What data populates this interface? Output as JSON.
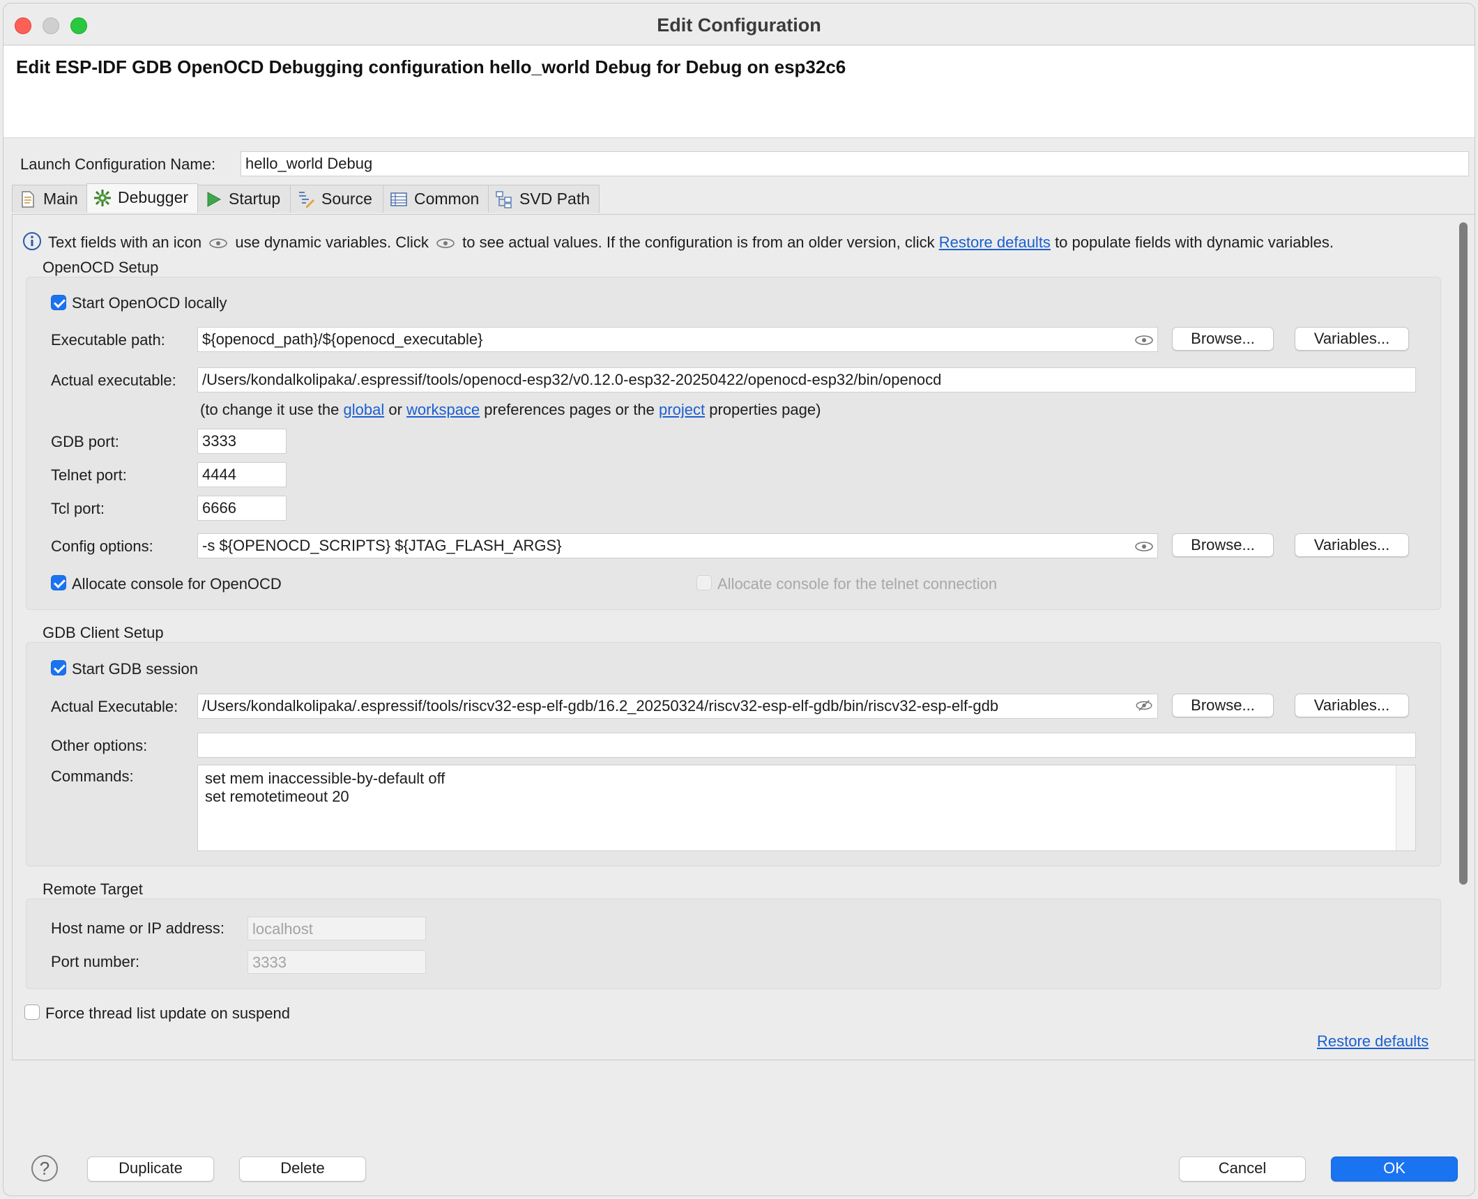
{
  "window": {
    "title": "Edit Configuration"
  },
  "header": {
    "text": "Edit ESP-IDF GDB OpenOCD Debugging configuration hello_world Debug for Debug on esp32c6"
  },
  "name_field": {
    "label": "Launch Configuration Name:",
    "value": "hello_world Debug"
  },
  "tabs": [
    {
      "label": "Main",
      "icon": "document-icon"
    },
    {
      "label": "Debugger",
      "icon": "bug-gear-icon",
      "active": true
    },
    {
      "label": "Startup",
      "icon": "play-icon"
    },
    {
      "label": "Source",
      "icon": "source-icon"
    },
    {
      "label": "Common",
      "icon": "table-icon"
    },
    {
      "label": "SVD Path",
      "icon": "hierarchy-icon"
    }
  ],
  "info": {
    "part1": "Text fields with an icon",
    "part2": "use dynamic variables. Click",
    "part3": "to see actual values. If the configuration is from an older version, click",
    "link": "Restore defaults",
    "part4": "to populate fields with dynamic variables."
  },
  "openocd": {
    "title": "OpenOCD Setup",
    "start_locally": {
      "label": "Start OpenOCD locally",
      "checked": true
    },
    "exec_path": {
      "label": "Executable path:",
      "value": "${openocd_path}/${openocd_executable}"
    },
    "actual_exec": {
      "label": "Actual executable:",
      "value": "/Users/kondalkolipaka/.espressif/tools/openocd-esp32/v0.12.0-esp32-20250422/openocd-esp32/bin/openocd"
    },
    "note": {
      "p1": "(to change it use the",
      "global": "global",
      "p2": "or",
      "workspace": "workspace",
      "p3": "preferences pages or the",
      "project": "project",
      "p4": "properties page)"
    },
    "gdb_port": {
      "label": "GDB port:",
      "value": "3333"
    },
    "telnet_port": {
      "label": "Telnet port:",
      "value": "4444"
    },
    "tcl_port": {
      "label": "Tcl port:",
      "value": "6666"
    },
    "config_options": {
      "label": "Config options:",
      "value": "-s ${OPENOCD_SCRIPTS} ${JTAG_FLASH_ARGS}"
    },
    "alloc_console": {
      "label": "Allocate console for OpenOCD",
      "checked": true
    },
    "alloc_telnet": {
      "label": "Allocate console for the telnet connection",
      "checked": false,
      "disabled": true
    }
  },
  "gdb": {
    "title": "GDB Client Setup",
    "start_session": {
      "label": "Start GDB session",
      "checked": true
    },
    "actual_exec": {
      "label": "Actual Executable:",
      "value": "/Users/kondalkolipaka/.espressif/tools/riscv32-esp-elf-gdb/16.2_20250324/riscv32-esp-elf-gdb/bin/riscv32-esp-elf-gdb"
    },
    "other_options": {
      "label": "Other options:",
      "value": ""
    },
    "commands": {
      "label": "Commands:",
      "line1": "set mem inaccessible-by-default off",
      "line2": "set remotetimeout 20"
    }
  },
  "remote": {
    "title": "Remote Target",
    "host": {
      "label": "Host name or IP address:",
      "value": "localhost"
    },
    "port": {
      "label": "Port number:",
      "value": "3333"
    }
  },
  "force_thread": {
    "label": "Force thread list update on suspend",
    "checked": false
  },
  "buttons": {
    "browse": "Browse...",
    "variables": "Variables...",
    "restore_defaults": "Restore defaults",
    "duplicate": "Duplicate",
    "delete": "Delete",
    "cancel": "Cancel",
    "ok": "OK",
    "help": "?"
  },
  "colors": {
    "accent": "#1a73f0",
    "link": "#1a5fd0",
    "close": "#fe5f57",
    "zoom": "#2ac840"
  }
}
